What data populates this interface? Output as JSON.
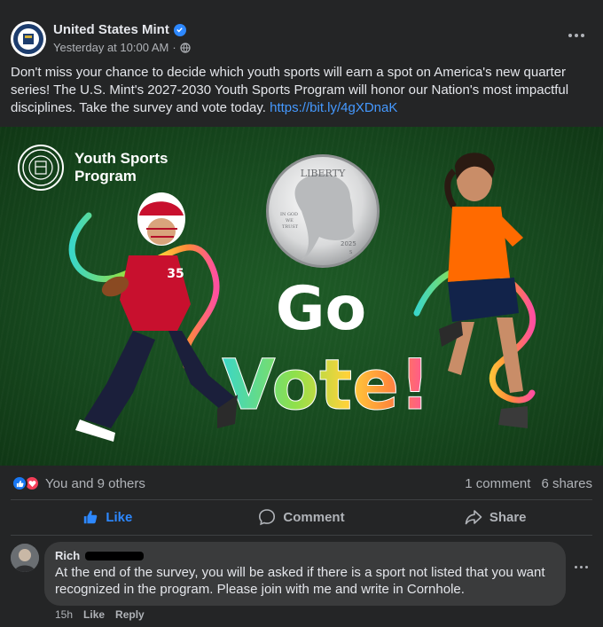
{
  "post": {
    "page_name": "United States Mint",
    "timestamp": "Yesterday at 10:00 AM",
    "separator": "·",
    "audience_icon": "globe-icon",
    "text": "Don't miss your chance to decide which youth sports will earn a spot on America's new quarter series! The U.S. Mint's 2027-2030 Youth Sports Program will honor our Nation's most impactful disciplines. Take the survey and vote today. ",
    "link": "https://bit.ly/4gXDnaK"
  },
  "image": {
    "program_title": "Youth Sports Program",
    "coin_top": "LIBERTY",
    "coin_motto": "IN GOD WE TRUST",
    "coin_year": "2025",
    "coin_mint": "S",
    "headline_1": "Go",
    "headline_2": "Vote!",
    "jersey_number": "35"
  },
  "engagement": {
    "reactions_text": "You and 9 others",
    "comments_text": "1 comment",
    "shares_text": "6 shares"
  },
  "actions": {
    "like": "Like",
    "comment": "Comment",
    "share": "Share"
  },
  "comment": {
    "author": "Rich",
    "text": "At the end of the survey, you will be asked if there is a sport not listed that you want recognized in the program. Please join with me and write in Cornhole.",
    "time": "15h",
    "like": "Like",
    "reply": "Reply"
  },
  "colors": {
    "background": "#242526",
    "link": "#4599ff",
    "like_blue": "#2d88ff",
    "love_red": "#f33e58",
    "image_green": "#1e5a26"
  }
}
